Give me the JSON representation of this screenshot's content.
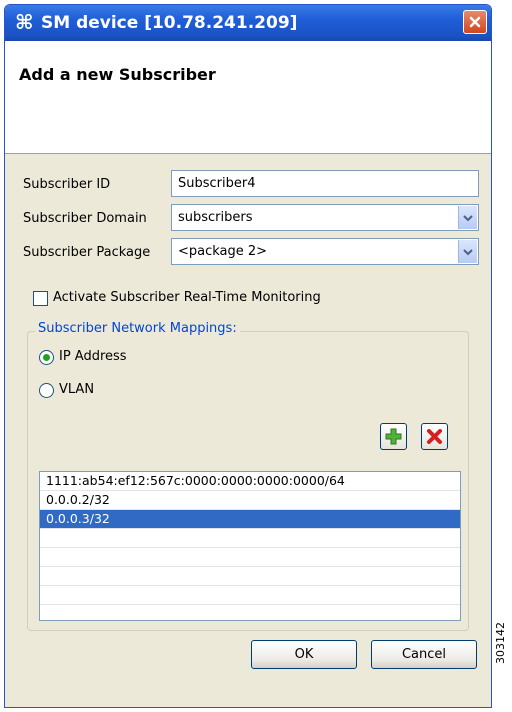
{
  "window": {
    "title": "SM device [10.78.241.209]",
    "icon": "cisco-command-icon",
    "heading": "Add a new Subscriber"
  },
  "form": {
    "subscriber_id": {
      "label": "Subscriber ID",
      "value": "Subscriber4"
    },
    "domain": {
      "label": "Subscriber Domain",
      "value": "subscribers"
    },
    "package": {
      "label": "Subscriber Package",
      "value": "<package 2>"
    },
    "monitoring": {
      "label": "Activate Subscriber Real-Time Monitoring",
      "checked": false
    }
  },
  "mappings": {
    "title": "Subscriber Network Mappings:",
    "radio_options": [
      {
        "label": "IP Address",
        "selected": true
      },
      {
        "label": "VLAN",
        "selected": false
      }
    ],
    "add_icon": "plus-icon",
    "remove_icon": "x-icon",
    "items": [
      "1111:ab54:ef12:567c:0000:0000:0000:0000/64",
      "0.0.0.2/32",
      "0.0.0.3/32"
    ],
    "selected_index": 2
  },
  "buttons": {
    "ok": "OK",
    "cancel": "Cancel"
  },
  "figure_id": "303142",
  "colors": {
    "titlebar": "#1f5ed8",
    "selection": "#316ac5",
    "group_title": "#0046d5",
    "dialog_bg": "#ece9d8"
  }
}
